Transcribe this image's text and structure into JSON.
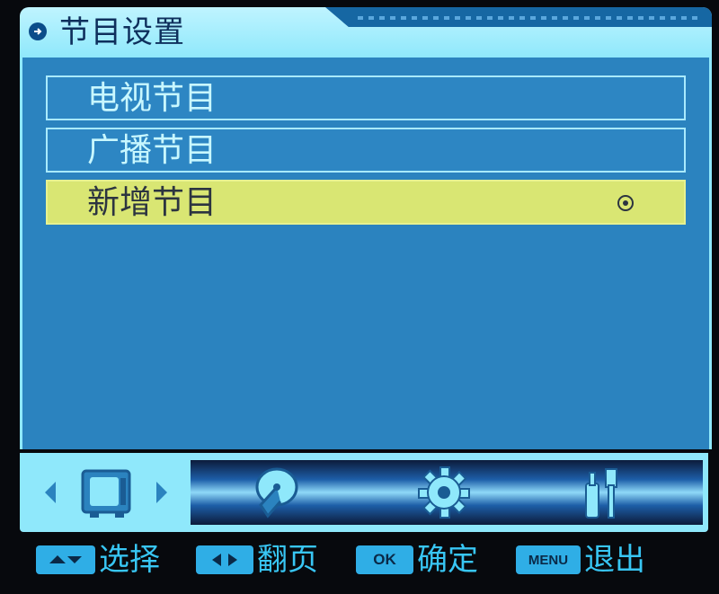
{
  "header": {
    "title": "节目设置",
    "icon": "arrow-circle-icon"
  },
  "menu": {
    "items": [
      {
        "label": "电视节目",
        "selected": false
      },
      {
        "label": "广播节目",
        "selected": false
      },
      {
        "label": "新增节目",
        "selected": true
      }
    ]
  },
  "iconbar": {
    "icons": [
      "tv-icon",
      "satellite-dish-icon",
      "gear-icon",
      "tools-icon"
    ]
  },
  "help": {
    "select_label": "选择",
    "page_label": "翻页",
    "ok_key": "OK",
    "ok_label": "确定",
    "menu_key": "MENU",
    "exit_label": "退出"
  },
  "colors": {
    "panel": "#2b83bf",
    "highlight": "#d9e673",
    "frame": "#8fe8fb",
    "help_text": "#38c6f4"
  }
}
